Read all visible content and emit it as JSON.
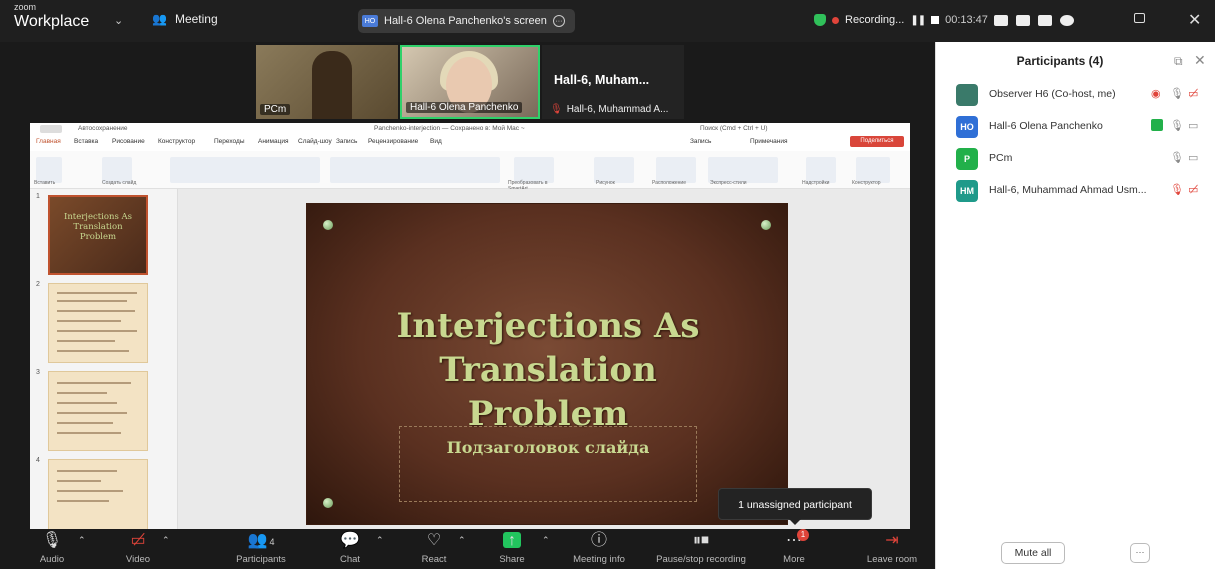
{
  "app": {
    "brand_small": "zoom",
    "brand": "Workplace",
    "meeting_label": "Meeting"
  },
  "screen_share": {
    "badge": "HO",
    "label": "Hall-6 Olena Panchenko's screen"
  },
  "recording": {
    "label": "Recording...",
    "timer": "00:13:47"
  },
  "gallery": {
    "tiles": [
      {
        "name": "PCm"
      },
      {
        "name": "Hall-6 Olena Panchenko"
      },
      {
        "name": "Hall-6,  Muham...",
        "sub": "Hall-6, Muhammad A..."
      }
    ]
  },
  "ppt": {
    "autosave": "Автосохранение",
    "file_title": "Panchenko-interjection — Сохранено в: Мой Mac ~",
    "search": "Поиск (Cmd + Ctrl + U)",
    "tabs": [
      "Главная",
      "Вставка",
      "Рисование",
      "Конструктор",
      "Переходы",
      "Анимация",
      "Слайд-шоу",
      "Запись",
      "Рецензирование",
      "Вид"
    ],
    "record_btn": "Запись",
    "comments_btn": "Примечания",
    "share_btn": "Поделиться",
    "ribbon_labels": [
      "Вставить",
      "Создать слайд",
      "Преобразовать в SmartArt",
      "Рисунок",
      "Расположение",
      "Экспресс-стили",
      "Надстройки",
      "Конструктор"
    ],
    "thumbnails": [
      {
        "num": "1",
        "title": "Interjections As Translation Problem"
      },
      {
        "num": "2"
      },
      {
        "num": "3"
      },
      {
        "num": "4"
      }
    ]
  },
  "slide": {
    "title_lines": [
      "Interjections As",
      "Translation",
      "Problem"
    ],
    "subtitle": "Подзаголовок слайда"
  },
  "tooltip": "1 unassigned participant",
  "toolbar": {
    "audio": "Audio",
    "video": "Video",
    "participants": "Participants",
    "participants_count": "4",
    "chat": "Chat",
    "react": "React",
    "share": "Share",
    "meeting_info": "Meeting info",
    "pause_stop": "Pause/stop recording",
    "more": "More",
    "more_badge": "1",
    "leave": "Leave room"
  },
  "participants_panel": {
    "title": "Participants (4)",
    "rows": [
      {
        "initials": "",
        "name": "Observer H6 (Co-host, me)",
        "avatar_color": "#3a7a6a"
      },
      {
        "initials": "HO",
        "name": "Hall-6 Olena Panchenko",
        "avatar_color": "#2f6fd6"
      },
      {
        "initials": "P",
        "name": "PCm",
        "avatar_color": "#22b04a"
      },
      {
        "initials": "HM",
        "name": "Hall-6, Muhammad Ahmad Usm...",
        "avatar_color": "#1f9a8a"
      }
    ],
    "mute_all": "Mute all",
    "more": "···"
  }
}
